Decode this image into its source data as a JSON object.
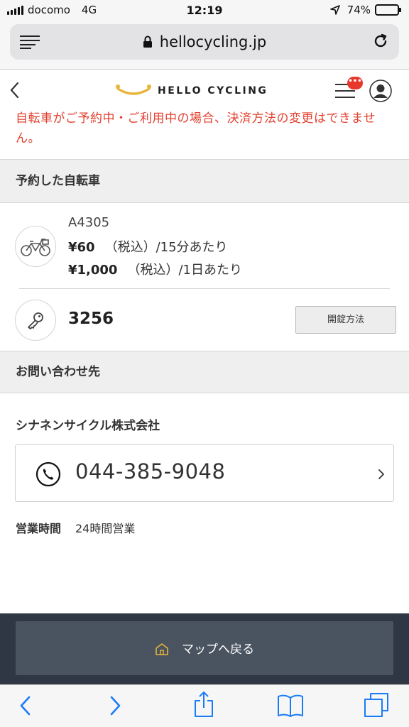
{
  "status_bar": {
    "carrier": "docomo",
    "network": "4G",
    "time": "12:19",
    "battery": "74%",
    "battery_level": 0.74
  },
  "browser": {
    "url": "hellocycling.jp"
  },
  "header": {
    "brand": "HELLO CYCLING",
    "notification_badge": "•••",
    "brand_color": "#e8b53a",
    "badge_color": "#e8382c"
  },
  "error_message": "自転車がご予約中・ご利用中の場合、決済方法の変更はできません。",
  "reserved_section": {
    "title": "予約した自転車",
    "bike_id": "A4305",
    "price_per_15min_amount": "¥60",
    "price_per_15min_note": "（税込）/15分あたり",
    "price_per_day_amount": "¥1,000",
    "price_per_day_note": "（税込）/1日あたり",
    "passcode": "3256",
    "unlock_button": "開錠方法"
  },
  "contact_section": {
    "title": "お問い合わせ先",
    "company": "シナネンサイクル株式会社",
    "phone": "044-385-9048",
    "hours_label": "営業時間",
    "hours_value": "24時間営業"
  },
  "bottom": {
    "back_to_map": "マップへ戻る"
  },
  "colors": {
    "error": "#e2402f",
    "bottom_panel": "#2f3744",
    "bottom_button": "#4a5360",
    "ios_blue": "#1a7cf5"
  },
  "icons": {
    "reader": "reader-icon",
    "lock": "lock-icon",
    "reload": "reload-icon",
    "back": "chevron-left-icon",
    "menu": "hamburger-menu-icon",
    "avatar": "user-avatar-icon",
    "bicycle": "bicycle-icon",
    "key": "key-icon",
    "phone": "phone-icon",
    "home": "home-icon",
    "share": "share-icon",
    "bookmarks": "book-icon",
    "tabs": "tabs-icon"
  }
}
